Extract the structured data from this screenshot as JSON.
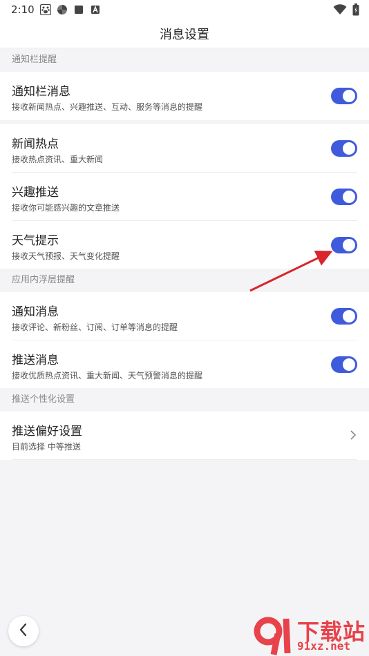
{
  "status_bar": {
    "time": "2:10",
    "left_icons": [
      "paw-icon",
      "pinwheel-icon",
      "square-icon",
      "letter-a-icon"
    ],
    "right_icons": [
      "wifi-icon",
      "battery-icon"
    ]
  },
  "header": {
    "title": "消息设置"
  },
  "sections": [
    {
      "label": "通知栏提醒",
      "items": [
        {
          "title": "通知栏消息",
          "desc": "接收新闻热点、兴趣推送、互动、服务等消息的提醒",
          "toggle": true
        }
      ]
    },
    {
      "label": "",
      "items": [
        {
          "title": "新闻热点",
          "desc": "接收热点资讯、重大新闻",
          "toggle": true
        },
        {
          "title": "兴趣推送",
          "desc": "接收你可能感兴趣的文章推送",
          "toggle": true
        },
        {
          "title": "天气提示",
          "desc": "接收天气预报、天气变化提醒",
          "toggle": true
        }
      ]
    },
    {
      "label": "应用内浮层提醒",
      "items": [
        {
          "title": "通知消息",
          "desc": "接收评论、新粉丝、订阅、订单等消息的提醒",
          "toggle": true
        },
        {
          "title": "推送消息",
          "desc": "接收优质热点资讯、重大新闻、天气预警消息的提醒",
          "toggle": true
        }
      ]
    },
    {
      "label": "推送个性化设置",
      "items": [
        {
          "title": "推送偏好设置",
          "desc": "目前选择 中等推送",
          "chevron": true
        }
      ]
    }
  ],
  "colors": {
    "accent": "#3f5bdc",
    "annotation_arrow": "#d9252b",
    "watermark": "#e8424a"
  },
  "watermark": {
    "brand": "下载站",
    "url": "91xz.net"
  },
  "nav": {
    "back_icon": "chevron-left-icon"
  }
}
